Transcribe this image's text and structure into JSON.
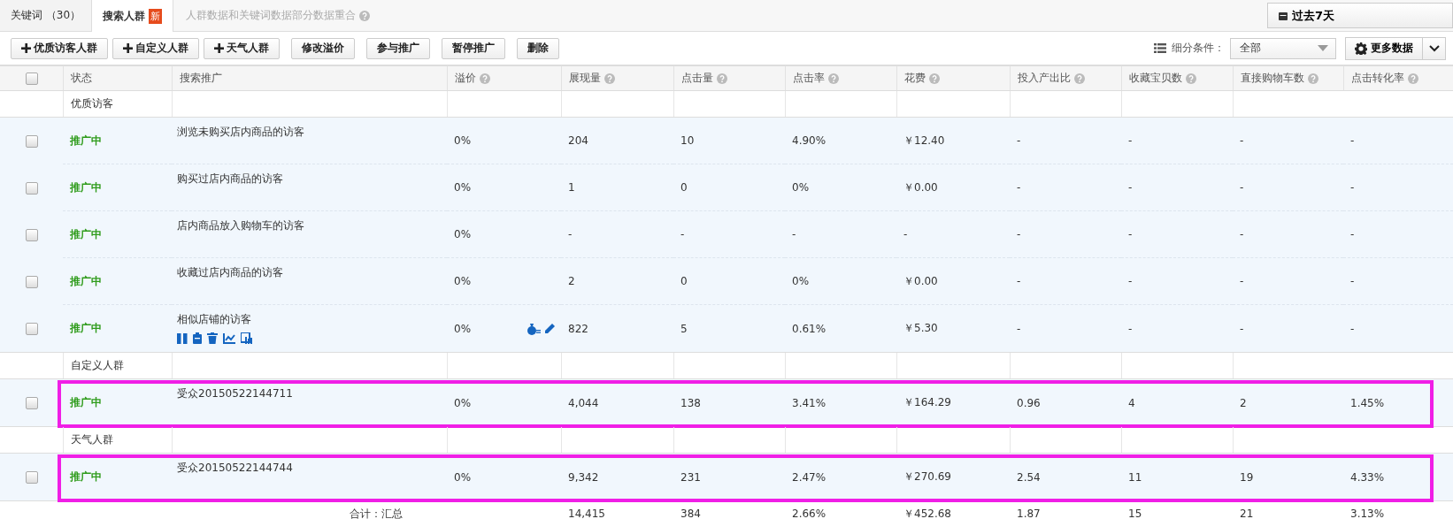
{
  "tabs": [
    {
      "label": "关键词 （30）",
      "selected": false
    },
    {
      "label": "搜索人群",
      "selected": true,
      "badge": "新"
    }
  ],
  "tab_note": "人群数据和关键词数据部分数据重合",
  "date_button": "过去7天",
  "toolbar_buttons": [
    {
      "label": "优质访客人群",
      "kind": "add"
    },
    {
      "label": "自定义人群",
      "kind": "add"
    },
    {
      "label": "天气人群",
      "kind": "add"
    },
    {
      "label": "修改溢价",
      "kind": "plain"
    },
    {
      "label": "参与推广",
      "kind": "plain"
    },
    {
      "label": "暂停推广",
      "kind": "plain"
    },
    {
      "label": "删除",
      "kind": "plain"
    }
  ],
  "filter": {
    "label": "细分条件：",
    "value": "全部"
  },
  "more_data_button": "更多数据",
  "table": {
    "select_all_checked": false,
    "columns": [
      {
        "label": "状态",
        "help": false
      },
      {
        "label": "搜索推广",
        "help": false
      },
      {
        "label": "溢价",
        "help": true
      },
      {
        "label": "展现量",
        "help": true
      },
      {
        "label": "点击量",
        "help": true
      },
      {
        "label": "点击率",
        "help": true
      },
      {
        "label": "花费",
        "help": true
      },
      {
        "label": "投入产出比",
        "help": true
      },
      {
        "label": "收藏宝贝数",
        "help": true
      },
      {
        "label": "直接购物车数",
        "help": true
      },
      {
        "label": "点击转化率",
        "help": true
      }
    ],
    "rows": [
      {
        "kind": "group",
        "name": "优质访客"
      },
      {
        "kind": "item",
        "checked": false,
        "status": "推广中",
        "name": "浏览未购买店内商品的访客",
        "hovered": false,
        "highlighted": false,
        "cells": [
          "0%",
          "204",
          "10",
          "4.90%",
          "￥12.40",
          "-",
          "-",
          "-",
          "-"
        ]
      },
      {
        "kind": "item",
        "checked": false,
        "status": "推广中",
        "name": "购买过店内商品的访客",
        "hovered": false,
        "highlighted": false,
        "cells": [
          "0%",
          "1",
          "0",
          "0%",
          "￥0.00",
          "-",
          "-",
          "-",
          "-"
        ]
      },
      {
        "kind": "item",
        "checked": false,
        "status": "推广中",
        "name": "店内商品放入购物车的访客",
        "hovered": false,
        "highlighted": false,
        "cells": [
          "0%",
          "-",
          "-",
          "-",
          "-",
          "-",
          "-",
          "-",
          "-"
        ]
      },
      {
        "kind": "item",
        "checked": false,
        "status": "推广中",
        "name": "收藏过店内商品的访客",
        "hovered": false,
        "highlighted": false,
        "cells": [
          "0%",
          "2",
          "0",
          "0%",
          "￥0.00",
          "-",
          "-",
          "-",
          "-"
        ]
      },
      {
        "kind": "item",
        "checked": false,
        "status": "推广中",
        "name": "相似店铺的访客",
        "hovered": true,
        "highlighted": false,
        "cells": [
          "0%",
          "822",
          "5",
          "0.61%",
          "￥5.30",
          "-",
          "-",
          "-",
          "-"
        ]
      },
      {
        "kind": "group",
        "name": "自定义人群"
      },
      {
        "kind": "item",
        "checked": false,
        "status": "推广中",
        "name": "受众20150522144711",
        "hovered": false,
        "highlighted": true,
        "cells": [
          "0%",
          "4,044",
          "138",
          "3.41%",
          "￥164.29",
          "0.96",
          "4",
          "2",
          "1.45%"
        ]
      },
      {
        "kind": "group",
        "name": "天气人群"
      },
      {
        "kind": "item",
        "checked": false,
        "status": "推广中",
        "name": "受众20150522144744",
        "hovered": false,
        "highlighted": true,
        "cells": [
          "0%",
          "9,342",
          "231",
          "2.47%",
          "￥270.69",
          "2.54",
          "11",
          "19",
          "4.33%"
        ]
      }
    ],
    "total": {
      "label": "合计：汇总",
      "cells": [
        "14,415",
        "384",
        "2.66%",
        "￥452.68",
        "1.87",
        "15",
        "21",
        "3.13%"
      ]
    }
  }
}
